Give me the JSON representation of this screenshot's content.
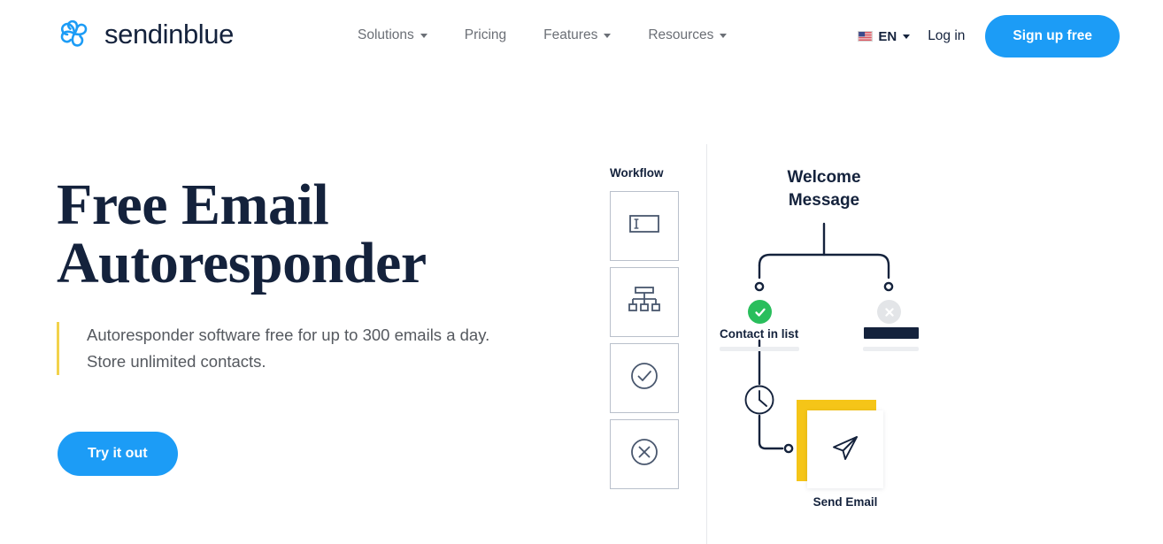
{
  "header": {
    "logo": {
      "icon": "sendinblue-pinwheel-logo-icon",
      "name": "sendinblue"
    },
    "nav_items": [
      {
        "label": "Solutions",
        "has_dropdown": true
      },
      {
        "label": "Pricing",
        "has_dropdown": false
      },
      {
        "label": "Features",
        "has_dropdown": true
      },
      {
        "label": "Resources",
        "has_dropdown": true
      }
    ],
    "language": {
      "flag_icon": "us-flag-icon",
      "label": "EN",
      "has_dropdown": true
    },
    "login_label": "Log in",
    "signup_label": "Sign up free"
  },
  "hero": {
    "title_line1": "Free Email",
    "title_line2": "Autoresponder",
    "subtitle_line1": "Autoresponder software free for up to 300 emails a day.",
    "subtitle_line2": "Store unlimited contacts.",
    "cta_label": "Try it out"
  },
  "workflow_panel": {
    "title": "Workflow",
    "cards": [
      {
        "icon": "text-input-field-icon"
      },
      {
        "icon": "hierarchy-tree-icon"
      },
      {
        "icon": "check-circle-icon"
      },
      {
        "icon": "x-circle-icon"
      }
    ]
  },
  "diagram": {
    "title_line1": "Welcome",
    "title_line2": "Message",
    "branch_yes": {
      "badge_icon": "green-check-badge-icon",
      "label": "Contact in list"
    },
    "branch_no": {
      "badge_icon": "gray-x-badge-icon",
      "label": ""
    },
    "delay": {
      "icon": "clock-icon"
    },
    "send_node": {
      "icon": "paper-plane-icon",
      "label": "Send Email"
    }
  },
  "colors": {
    "brand_blue": "#1C9CF6",
    "navy": "#14223C",
    "yellow_accent": "#F2D24B",
    "yellow_card": "#F5C518",
    "green_success": "#29BE5C",
    "gray_disabled": "#E3E5E8",
    "body_text": "#55595f",
    "nav_text": "#6b6f76"
  }
}
